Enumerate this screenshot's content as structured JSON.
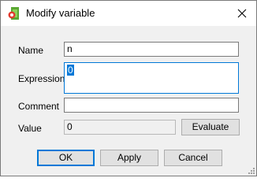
{
  "window": {
    "title": "Modify variable",
    "app_icon": "variable-app-icon",
    "close_icon": "close-icon"
  },
  "form": {
    "name_label": "Name",
    "name_value": "n",
    "expression_label": "Expression",
    "expression_value": "0",
    "comment_label": "Comment",
    "comment_value": "",
    "value_label": "Value",
    "value_value": "0",
    "evaluate_label": "Evaluate"
  },
  "buttons": {
    "ok_label": "OK",
    "apply_label": "Apply",
    "cancel_label": "Cancel"
  },
  "colors": {
    "accent": "#0078d7",
    "dialog_bg": "#f0f0f0",
    "titlebar_bg": "#ffffff"
  }
}
